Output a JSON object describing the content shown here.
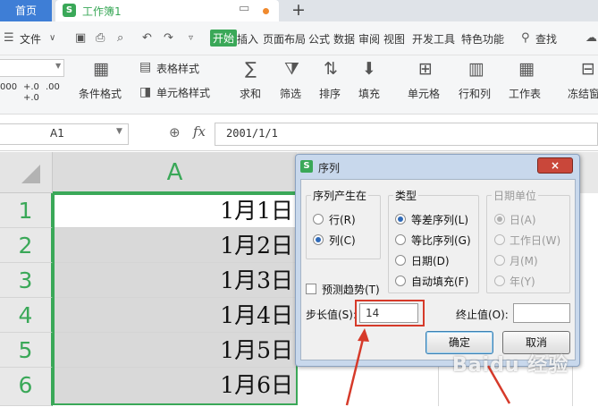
{
  "tabs": {
    "home": "首页",
    "doc_logo": "S",
    "doc_title": "工作簿1"
  },
  "menu": {
    "file": "文件",
    "items": [
      "开始",
      "插入",
      "页面布局",
      "公式",
      "数据",
      "审阅",
      "视图",
      "开发工具",
      "特色功能"
    ],
    "search": "查找"
  },
  "ribbon": {
    "format_nums": [
      "000",
      "+.0",
      ".00",
      "+.0"
    ],
    "cond_format": "条件格式",
    "table_style": "表格样式",
    "cell_style": "单元格样式",
    "sum": "求和",
    "filter": "筛选",
    "sort": "排序",
    "fill": "填充",
    "cell": "单元格",
    "rows_cols": "行和列",
    "worksheet": "工作表",
    "freeze": "冻结窗"
  },
  "formula_bar": {
    "name_box": "A1",
    "fx": "fx",
    "value": "2001/1/1"
  },
  "sheet": {
    "column_a": "A",
    "rows": [
      {
        "num": "1",
        "value": "1月1日"
      },
      {
        "num": "2",
        "value": "1月2日"
      },
      {
        "num": "3",
        "value": "1月3日"
      },
      {
        "num": "4",
        "value": "1月4日"
      },
      {
        "num": "5",
        "value": "1月5日"
      },
      {
        "num": "6",
        "value": "1月6日"
      }
    ]
  },
  "dialog": {
    "logo": "S",
    "title": "序列",
    "close": "×",
    "series_in": {
      "title": "序列产生在",
      "options": [
        "行(R)",
        "列(C)"
      ],
      "selected": "列(C)"
    },
    "type": {
      "title": "类型",
      "options": [
        "等差序列(L)",
        "等比序列(G)",
        "日期(D)",
        "自动填充(F)"
      ],
      "selected": "等差序列(L)"
    },
    "date_unit": {
      "title": "日期单位",
      "options": [
        "日(A)",
        "工作日(W)",
        "月(M)",
        "年(Y)"
      ],
      "selected": "日(A)",
      "disabled": true
    },
    "trend": "预测趋势(T)",
    "step_label": "步长值(S):",
    "step_value": "14",
    "stop_label": "终止值(O):",
    "stop_value": "",
    "ok": "确定",
    "cancel": "取消"
  },
  "watermark": "Baidu 经验",
  "colors": {
    "accent": "#3aa858",
    "home_tab": "#3e7ed6",
    "highlight": "#d63a2a"
  }
}
